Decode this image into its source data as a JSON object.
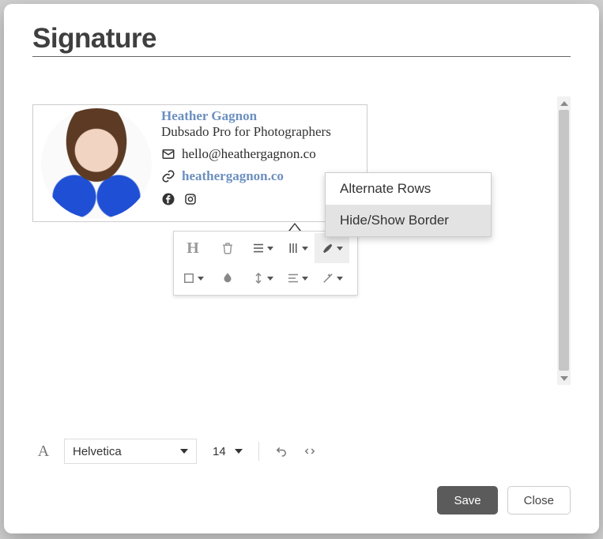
{
  "modal": {
    "title": "Signature"
  },
  "signature": {
    "name": "Heather Gagnon",
    "subtitle": "Dubsado Pro for Photographers",
    "email": "hello@heathergagnon.co",
    "website": "heathergagnon.co",
    "icons": {
      "email": "mail-icon",
      "link": "link-icon",
      "facebook": "facebook-icon",
      "instagram": "instagram-icon"
    }
  },
  "table_menu": {
    "items": [
      "Alternate Rows",
      "Hide/Show Border"
    ],
    "hover_index": 1
  },
  "float_toolbar": {
    "row1": [
      "heading",
      "delete",
      "align",
      "columns",
      "brush"
    ],
    "row2": [
      "border-style",
      "tint",
      "height",
      "align2",
      "magic"
    ]
  },
  "bottom_toolbar": {
    "font_family": "Helvetica",
    "font_size": "14",
    "buttons": [
      "text-color",
      "undo",
      "code-view"
    ]
  },
  "footer": {
    "save": "Save",
    "close": "Close"
  }
}
